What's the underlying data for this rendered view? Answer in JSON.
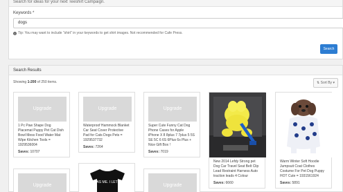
{
  "search": {
    "header_text": "Search for ideas for your next Teeshirt Campaign.",
    "keywords_label": "Keywords *",
    "keywords_value": "dogs",
    "tip_icon": "info-icon",
    "tip_text": "Tip: You may want to include \"shirt\" in your keywords to get shirt images. Not recommended for Cafe Press.",
    "button_label": "Search"
  },
  "results": {
    "header_title": "Search Results",
    "showing_prefix": "Showing ",
    "showing_range": "1-200",
    "showing_of": " of ",
    "showing_total": "250",
    "showing_suffix": " items.",
    "sort_label": "Sort By",
    "sort_icon": "sort-icon",
    "upgrade_label": "Upgrade",
    "saves_label": "Saves: ",
    "cards": [
      {
        "title": "1 Pc Paw Shape Dog Placemat Puppy Pet Cat Dish Bowl Mess Food Water Mat Wipe Kitchen Tools = 1929536004",
        "saves": "10707"
      },
      {
        "title": "Waterproof Hammock Blanket Car Seat Cover Protective Pad for Cats Dogs Pets = 1929537732",
        "saves": "7264"
      },
      {
        "title": "Super Cute Funny Cat Dog Phone Cases for Apple iPhone X 8 8plus 7 7plus 5 5S SE 5C 6 6S 6Plus 6s Plus + Nice Gift Box !",
        "saves": "7019"
      },
      {
        "title": "New 2014 Lefdy Strong pet Dog Car Travel Seat Belt Clip Lead Restraint Harness Auto traction leads 4 Colour",
        "saves": "6660"
      },
      {
        "title": "Warm Winter Soft Hoodie Jumpsuit Coat Clothes Costume For Pet Dog Puppy HOT Cute = 1931561924",
        "saves": "5891"
      }
    ],
    "second_row_shirt_text": "IT WAS ME. I LET THE"
  }
}
